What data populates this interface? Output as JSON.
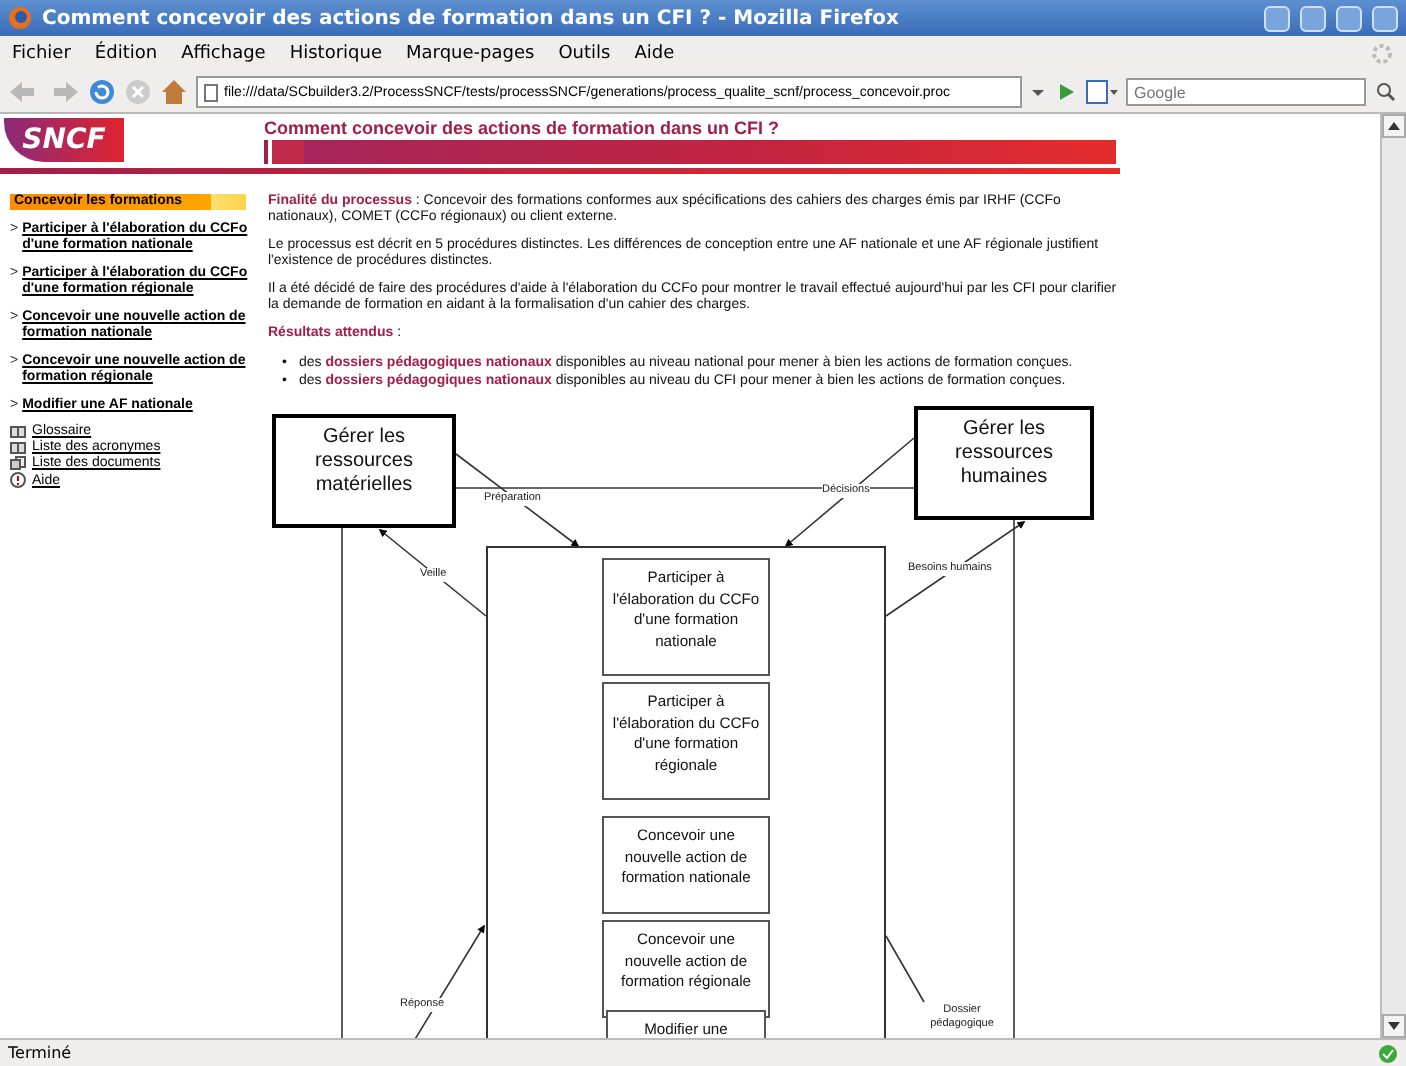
{
  "window": {
    "title": "Comment concevoir des actions de formation dans un CFI ? - Mozilla Firefox"
  },
  "menu": [
    "Fichier",
    "Édition",
    "Affichage",
    "Historique",
    "Marque-pages",
    "Outils",
    "Aide"
  ],
  "navbar": {
    "url": "file:///data/SCbuilder3.2/ProcessSNCF/tests/processSNCF/generations/process_qualite_scnf/process_concevoir.proc",
    "search_placeholder": "Google"
  },
  "header": {
    "logo": "SNCF",
    "title": "Comment concevoir des actions de formation dans un CFI ?"
  },
  "sidebar": {
    "section": "Concevoir les formations",
    "marker": ">",
    "links": [
      "Participer à l'élaboration du CCFo d'une formation nationale",
      "Participer à l'élaboration du CCFo d'une formation régionale",
      "Concevoir une nouvelle action de formation nationale",
      "Concevoir une nouvelle action de formation régionale",
      "Modifier une AF nationale"
    ],
    "tools": [
      {
        "kind": "book",
        "label": "Glossaire"
      },
      {
        "kind": "book",
        "label": "Liste des acronymes"
      },
      {
        "kind": "docs",
        "label": "Liste des documents"
      },
      {
        "kind": "help",
        "label": "Aide"
      }
    ]
  },
  "content": {
    "paragraphs": [
      "**Finalité du processus** : Concevoir des formations conformes aux spécifications des cahiers des charges émis par IRHF (CCFo nationaux), COMET (CCFo régionaux) ou client externe.",
      "Le processus est décrit en 5 procédures distinctes. Les différences de conception entre une AF nationale et une AF régionale justifient l'existence de procédures distinctes.",
      "Il a été décidé de faire des procédures d'aide à l'élaboration du CCFo pour montrer le travail effectué aujourd'hui par les CFI pour clarifier la demande de formation en aidant à la formalisation d'un cahier des charges."
    ],
    "results_heading": "**Résultats attendus** :",
    "bullet": "•",
    "results": [
      "des **dossiers pédagogiques nationaux** disponibles au niveau national pour mener à bien les actions de formation conçues.",
      "des **dossiers pédagogiques nationaux** disponibles au niveau du CFI pour mener à bien les actions de formation conçues."
    ]
  },
  "diagram": {
    "nodes": [
      {
        "kind": "major",
        "label": "Gérer les ressources matérielles"
      },
      {
        "kind": "major",
        "label": "Gérer les ressources humaines"
      },
      {
        "kind": "container"
      },
      {
        "kind": "process",
        "label": "Participer à l'élaboration du CCFo d'une formation nationale"
      },
      {
        "kind": "process",
        "label": "Participer à l'élaboration du CCFo d'une formation régionale"
      },
      {
        "kind": "process",
        "label": "Concevoir une nouvelle action de formation nationale"
      },
      {
        "kind": "process",
        "label": "Concevoir une nouvelle action de formation régionale"
      },
      {
        "kind": "process",
        "label": "Modifier une"
      }
    ],
    "flows": [
      "Préparation",
      "Décisions",
      "Veille",
      "Besoins humains",
      "Réponse",
      "Dossier pédagogique"
    ]
  },
  "status_bar": {
    "text": "Terminé"
  }
}
